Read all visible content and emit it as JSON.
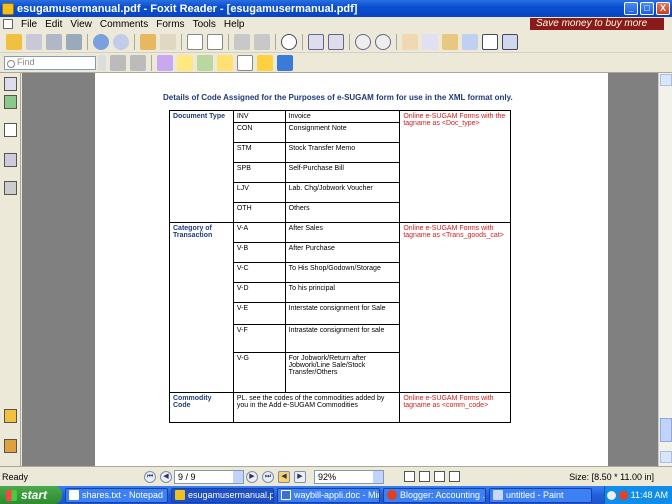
{
  "window": {
    "title": "esugamusermanual.pdf - Foxit Reader - [esugamusermanual.pdf]",
    "controls": [
      "_",
      "□",
      "X"
    ]
  },
  "menu": {
    "items": [
      "File",
      "Edit",
      "View",
      "Comments",
      "Forms",
      "Tools",
      "Help"
    ],
    "promo": "Save money to buy more e-books"
  },
  "toolbar2": {
    "find_placeholder": "Find"
  },
  "document": {
    "heading": "Details of Code Assigned for the Purposes of e-SUGAM form for use in the XML format only.",
    "sections": [
      {
        "category": "Document Type",
        "online": "Online e-SUGAM Forms with the tagname as <Doc_type>",
        "rows": [
          {
            "code": "INV",
            "desc": "Invoice"
          },
          {
            "code": "CON",
            "desc": "Consignment Note"
          },
          {
            "code": "STM",
            "desc": "Stock Transfer Memo"
          },
          {
            "code": "SPB",
            "desc": "Self-Purchase Bill"
          },
          {
            "code": "LJV",
            "desc": "Lab. Chg/Jobwork Voucher"
          },
          {
            "code": "OTH",
            "desc": "Others"
          }
        ]
      },
      {
        "category": "Category of Transaction",
        "online": "Online e-SUGAM Forms with tagname as <Trans_goods_cat>",
        "rows": [
          {
            "code": "V-A",
            "desc": "After Sales"
          },
          {
            "code": "V-B",
            "desc": "After Purchase"
          },
          {
            "code": "V-C",
            "desc": "To His Shop/Godown/Storage"
          },
          {
            "code": "V-D",
            "desc": "To his principal"
          },
          {
            "code": "V-E",
            "desc": "Interstate consignment for Sale"
          },
          {
            "code": "V-F",
            "desc": "Intrastate consignment for sale"
          },
          {
            "code": "V-G",
            "desc": "For Jobwork/Return after Jobwork/Line Sale/Stock Transfer/Others"
          }
        ]
      },
      {
        "category": "Commodity Code",
        "combined": "PL. see the codes of the commodities added by you in the Add e-SUGAM Commodities",
        "online": "Online e-SUGAM Forms with tagname as <comm_code>"
      }
    ]
  },
  "status": {
    "ready": "Ready",
    "page": "9 / 9",
    "zoom": "92%",
    "size": "Size: [8.50 * 11.00 in]"
  },
  "taskbar": {
    "start": "start",
    "tasks": [
      {
        "label": "shares.txt - Notepad",
        "active": false
      },
      {
        "label": "esugamusermanual.p...",
        "active": true
      },
      {
        "label": "waybill-appli.doc - Mic...",
        "active": false
      },
      {
        "label": "Blogger: Accounting ...",
        "active": false
      },
      {
        "label": "untitled - Paint",
        "active": false
      }
    ],
    "clock": "11:48 AM"
  }
}
